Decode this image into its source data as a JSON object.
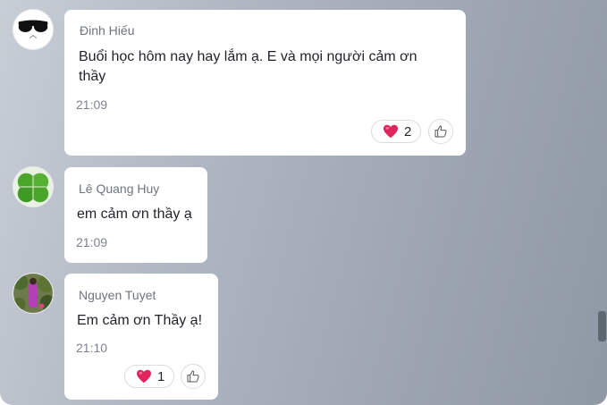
{
  "messages": [
    {
      "sender": "Đinh Hiếu",
      "text_line1": "Buổi học hôm nay hay lắm ạ. E và mọi người cảm ơn",
      "text_line2": "thầy",
      "time": "21:09",
      "reaction_icon": "heart-icon",
      "reaction_count": "2",
      "avatar": "sunglasses-avatar"
    },
    {
      "sender": "Lê Quang Huy",
      "text": "em cảm ơn thầy ạ",
      "time": "21:09",
      "avatar": "clover-avatar"
    },
    {
      "sender": "Nguyen Tuyet",
      "text": "Em cảm ơn Thầy ạ!",
      "time": "21:10",
      "reaction_icon": "heart-icon",
      "reaction_count": "1",
      "avatar": "photo-avatar"
    }
  ],
  "colors": {
    "heart": "#e0245e",
    "bubble": "#ffffff",
    "background": "#a3abb6"
  }
}
